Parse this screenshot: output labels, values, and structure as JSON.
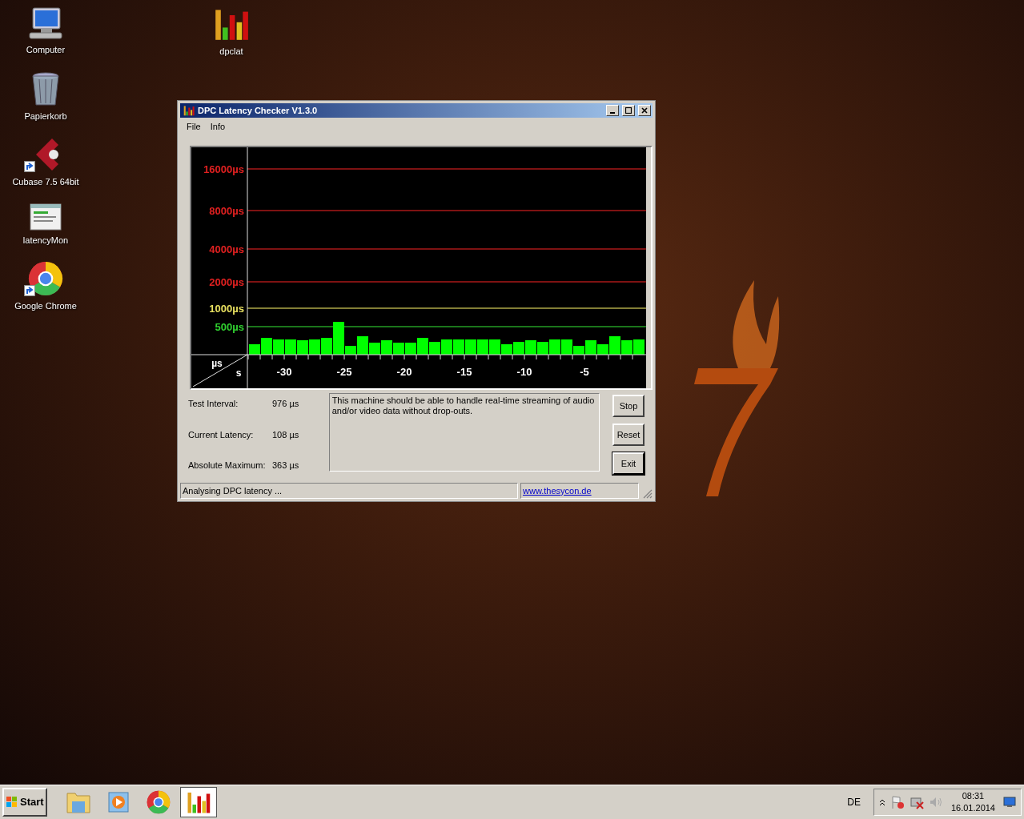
{
  "desktop_icons": [
    {
      "label": "Computer",
      "kind": "computer"
    },
    {
      "label": "Papierkorb",
      "kind": "recycle"
    },
    {
      "label": "Cubase 7.5 64bit",
      "kind": "cubase",
      "shortcut": true
    },
    {
      "label": "latencyMon",
      "kind": "latencymon",
      "shortcut": false
    },
    {
      "label": "Google Chrome",
      "kind": "chrome",
      "shortcut": true
    },
    {
      "label": "dpclat",
      "kind": "dpclat"
    }
  ],
  "window": {
    "title": "DPC Latency Checker V1.3.0",
    "menu": [
      "File",
      "Info"
    ],
    "graph": {
      "x_unit": "s",
      "y_unit": "µs",
      "x_labels": [
        "-30",
        "-25",
        "-20",
        "-15",
        "-10",
        "-5"
      ],
      "y_labels": [
        {
          "label": "16000µs",
          "color": "#e02020"
        },
        {
          "label": "8000µs",
          "color": "#e02020"
        },
        {
          "label": "4000µs",
          "color": "#e02020"
        },
        {
          "label": "2000µs",
          "color": "#e02020"
        },
        {
          "label": "1000µs",
          "color": "#e8e060"
        },
        {
          "label": "500µs",
          "color": "#30d030"
        }
      ]
    },
    "readings": [
      {
        "label": "Test Interval:",
        "value": "976 µs"
      },
      {
        "label": "Current Latency:",
        "value": "108 µs"
      },
      {
        "label": "Absolute Maximum:",
        "value": "363 µs"
      }
    ],
    "message": "This machine should be able to handle real-time streaming of audio and/or video data without drop-outs.",
    "buttons": [
      {
        "label": "Stop",
        "default": false
      },
      {
        "label": "Reset",
        "default": false
      },
      {
        "label": "Exit",
        "default": true
      }
    ],
    "status_bar": {
      "text": "Analysing DPC latency ...",
      "link": "www.thesycon.de"
    }
  },
  "taskbar": {
    "start_label": "Start",
    "apps": [
      {
        "kind": "explorer",
        "selected": false
      },
      {
        "kind": "media",
        "selected": false
      },
      {
        "kind": "chrome",
        "selected": false
      },
      {
        "kind": "dpclat",
        "selected": true
      }
    ],
    "language": "DE",
    "time": "08:31",
    "date": "16.01.2014"
  }
}
